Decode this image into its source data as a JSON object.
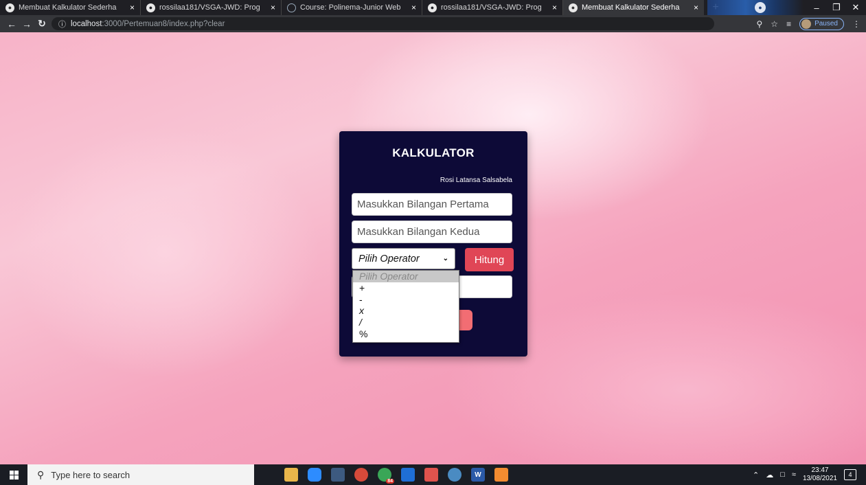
{
  "browser": {
    "tabs": [
      {
        "title": "Membuat Kalkulator Sederha",
        "icon": "globe-icon",
        "active": false
      },
      {
        "title": "rossilaa181/VSGA-JWD: Prog",
        "icon": "github-icon",
        "active": false
      },
      {
        "title": "Course: Polinema-Junior Web",
        "icon": "course-icon",
        "active": false
      },
      {
        "title": "rossilaa181/VSGA-JWD: Prog",
        "icon": "github-icon",
        "active": false
      },
      {
        "title": "Membuat Kalkulator Sederha",
        "icon": "globe-icon",
        "active": true
      }
    ],
    "close_glyph": "×",
    "new_tab_glyph": "+",
    "address": {
      "host": "localhost",
      "path": ":3000/Pertemuan8/index.php?clear"
    },
    "profile_status": "Paused"
  },
  "calculator": {
    "title": "KALKULATOR",
    "author": "Rosi Latansa Salsabela",
    "first_placeholder": "Masukkan Bilangan Pertama",
    "second_placeholder": "Masukkan Bilangan Kedua",
    "operator_selected": "Pilih Operator",
    "operator_options": [
      "Pilih Operator",
      "+",
      "-",
      "x",
      "/",
      "%"
    ],
    "submit_label": "Hitung"
  },
  "taskbar": {
    "search_placeholder": "Type here to search",
    "time": "23:47",
    "date": "13/08/2021",
    "notification_count": "4",
    "chrome_badge": "84"
  },
  "colors": {
    "card_bg": "#0d0a37",
    "submit_bg": "#e04656",
    "page_bg": "#f4a9c0"
  }
}
